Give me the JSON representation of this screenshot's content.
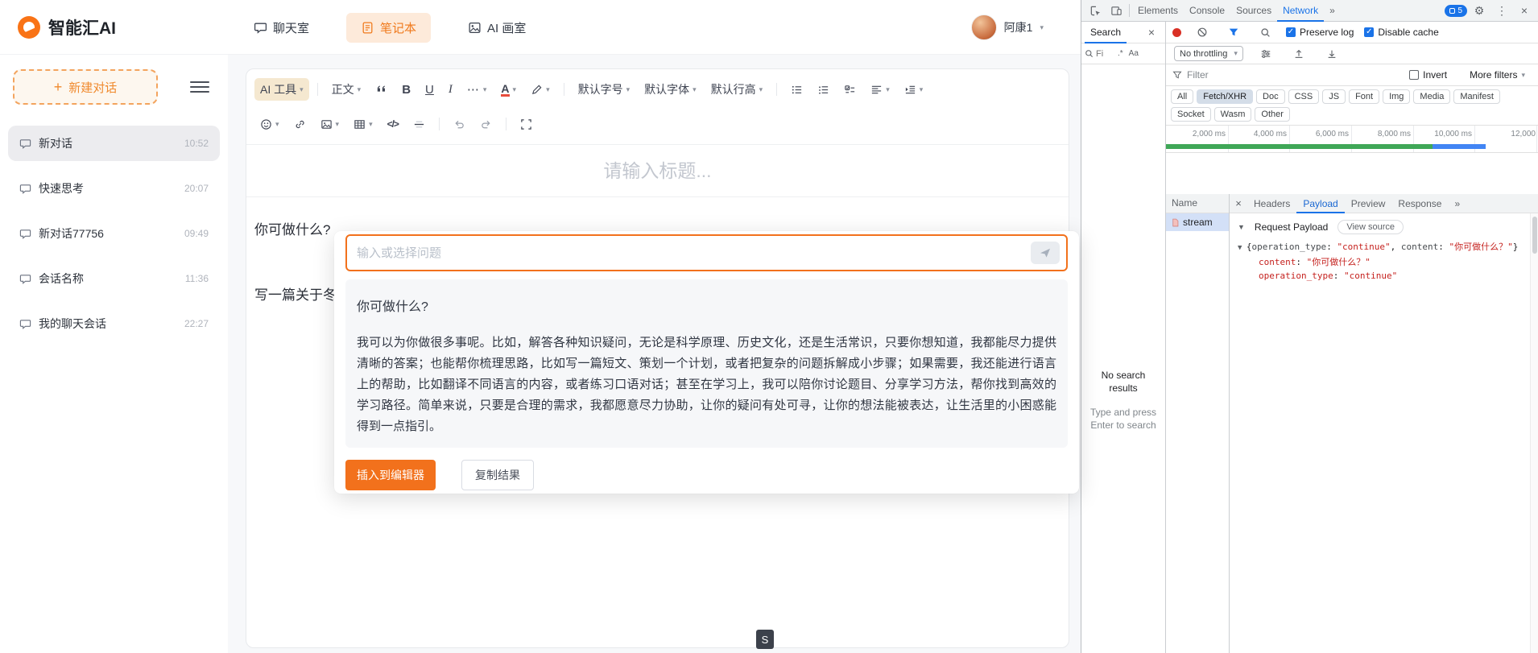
{
  "colors": {
    "accent_orange": "#f2711c",
    "notebook_tab_bg": "#fdeada",
    "devtools_blue": "#1a73e8",
    "record_red": "#d93025",
    "json_value_red": "#c5221f",
    "timeline_green": "#3fa757",
    "timeline_blue": "#4285f4",
    "selected_row_blue": "#d3e0f7"
  },
  "header": {
    "brand": "智能汇AI",
    "nav": {
      "chat": "聊天室",
      "notebook": "笔记本",
      "studio": "AI 画室"
    },
    "user_name": "阿康1"
  },
  "sidebar": {
    "new_chat_label": "新建对话",
    "items": [
      {
        "label": "新对话",
        "time": "10:52"
      },
      {
        "label": "快速思考",
        "time": "20:07"
      },
      {
        "label": "新对话77756",
        "time": "09:49"
      },
      {
        "label": "会话名称",
        "time": "11:36"
      },
      {
        "label": "我的聊天会话",
        "time": "22:27"
      }
    ]
  },
  "editor": {
    "ai_tool_label": "AI 工具",
    "paragraph_label": "正文",
    "font_size_label": "默认字号",
    "font_family_label": "默认字体",
    "line_height_label": "默认行高",
    "title_placeholder": "请输入标题...",
    "body_question": "你可做什么?",
    "body_draft": "写一篇关于冬"
  },
  "popup": {
    "input_placeholder": "输入或选择问题",
    "result_title": "你可做什么?",
    "result_body": "我可以为你做很多事呢。比如，解答各种知识疑问，无论是科学原理、历史文化，还是生活常识，只要你想知道，我都能尽力提供清晰的答案；也能帮你梳理思路，比如写一篇短文、策划一个计划，或者把复杂的问题拆解成小步骤；如果需要，我还能进行语言上的帮助，比如翻译不同语言的内容，或者练习口语对话；甚至在学习上，我可以陪你讨论题目、分享学习方法，帮你找到高效的学习路径。简单来说，只要是合理的需求，我都愿意尽力协助，让你的疑问有处可寻，让你的想法能被表达，让生活里的小困惑能得到一点指引。",
    "insert_label": "插入到编辑器",
    "copy_label": "复制结果"
  },
  "footer_badge": "S",
  "devtools": {
    "tabs": {
      "elements": "Elements",
      "console": "Console",
      "sources": "Sources",
      "network": "Network",
      "overflow": "»"
    },
    "issues_count": "5",
    "search_panel": {
      "tab_label": "Search",
      "input_text": "Fi",
      "regex_label": ".*",
      "case_label": "Aa",
      "empty_title": "No search results",
      "empty_hint": "Type and press Enter to search"
    },
    "network": {
      "preserve_log_label": "Preserve log",
      "disable_cache_label": "Disable cache",
      "throttling_value": "No throttling",
      "filter_placeholder": "Filter",
      "invert_label": "Invert",
      "more_filters_label": "More filters",
      "chips": [
        "All",
        "Fetch/XHR",
        "Doc",
        "CSS",
        "JS",
        "Font",
        "Img",
        "Media",
        "Manifest",
        "Socket",
        "Wasm",
        "Other"
      ],
      "active_chip": "Fetch/XHR",
      "timeline_ticks": [
        "2,000 ms",
        "4,000 ms",
        "6,000 ms",
        "8,000 ms",
        "10,000 ms",
        "12,000"
      ],
      "name_header": "Name",
      "request_name": "stream",
      "detail_tabs": {
        "headers": "Headers",
        "payload": "Payload",
        "preview": "Preview",
        "response": "Response",
        "overflow": "»"
      }
    },
    "payload": {
      "section_label": "Request Payload",
      "view_source_label": "View source",
      "punct": {
        "open": "{",
        "close": "}",
        "comma": ", ",
        "colon": ": "
      },
      "summary": {
        "key1": "operation_type",
        "value1": "\"continue\"",
        "key2": "content",
        "value2": "\"你可做什么？\""
      },
      "entries": [
        {
          "key": "content",
          "value": "\"你可做什么？\""
        },
        {
          "key": "operation_type",
          "value": "\"continue\""
        }
      ]
    }
  }
}
